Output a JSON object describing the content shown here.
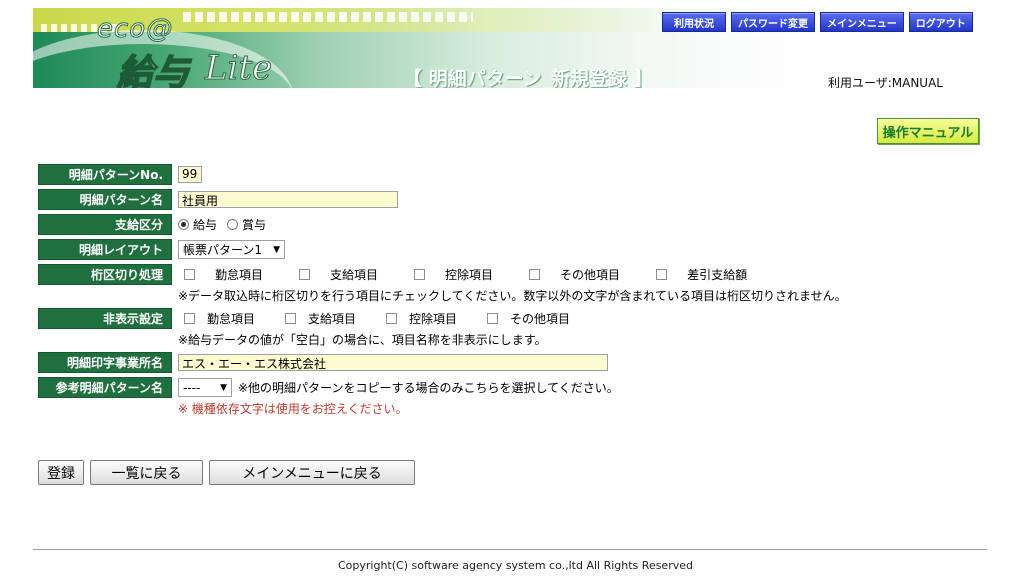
{
  "header": {
    "logo_eco": "eco@",
    "logo_main": "給与",
    "logo_lite": "Lite",
    "page_title": "【 明細パターン_新規登録 】",
    "user_label": "利用ユーザ:MANUAL",
    "nav": {
      "usage": "利用状況",
      "password": "パスワード変更",
      "main_menu": "メインメニュー",
      "logout": "ログアウト"
    },
    "manual_button": "操作マニュアル"
  },
  "form": {
    "pattern_no": {
      "label": "明細パターンNo.",
      "value": "99"
    },
    "pattern_name": {
      "label": "明細パターン名",
      "value": "社員用"
    },
    "payment_type": {
      "label": "支給区分",
      "options": [
        "給与",
        "賞与"
      ],
      "selected": "給与"
    },
    "layout": {
      "label": "明細レイアウト",
      "value": "帳票パターン1"
    },
    "digit_separator": {
      "label": "桁区切り処理",
      "options": [
        "勤怠項目",
        "支給項目",
        "控除項目",
        "その他項目",
        "差引支給額"
      ],
      "note": "※データ取込時に桁区切りを行う項目にチェックしてください。数字以外の文字が含まれている項目は桁区切りされません。"
    },
    "hidden_setting": {
      "label": "非表示設定",
      "options": [
        "勤怠項目",
        "支給項目",
        "控除項目",
        "その他項目"
      ],
      "note": "※給与データの値が「空白」の場合に、項目名称を非表示にします。"
    },
    "office_name": {
      "label": "明細印字事業所名",
      "value": "エス・エー・エス株式会社"
    },
    "reference_pattern": {
      "label": "参考明細パターン名",
      "value": "----",
      "note": "※他の明細パターンをコピーする場合のみこちらを選択してください。"
    },
    "warning": "※ 機種依存文字は使用をお控えください。"
  },
  "actions": {
    "register": "登録",
    "back_to_list": "一覧に戻る",
    "back_to_menu": "メインメニューに戻る"
  },
  "footer": {
    "copyright": "Copyright(C) software agency system co.,ltd All Rights Reserved"
  }
}
